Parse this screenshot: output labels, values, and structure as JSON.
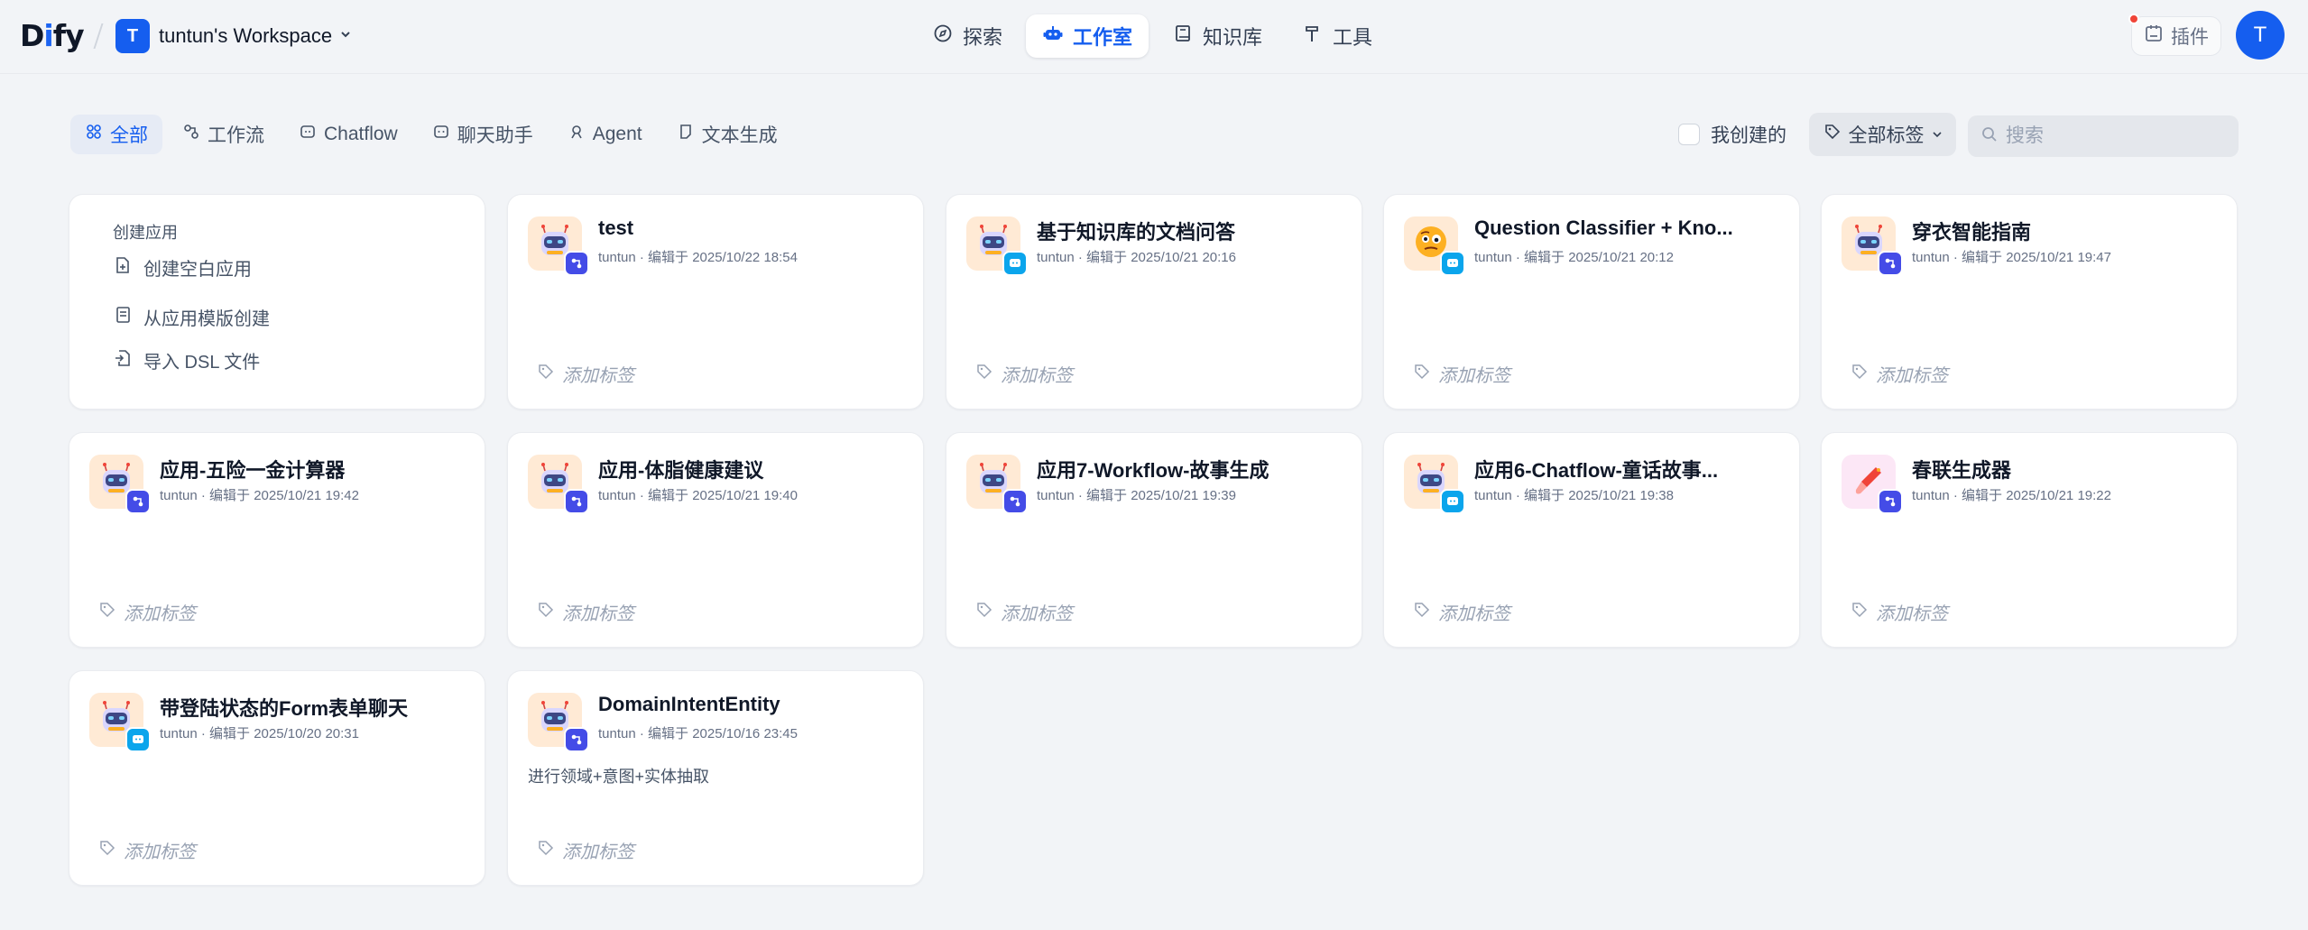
{
  "header": {
    "logo_prefix": "D",
    "logo_i": "i",
    "logo_suffix": "fy",
    "workspace_initial": "T",
    "workspace_name": "tuntun's Workspace",
    "nav": [
      {
        "label": "探索",
        "icon": "compass-icon",
        "active": false
      },
      {
        "label": "工作室",
        "icon": "robot-icon",
        "active": true
      },
      {
        "label": "知识库",
        "icon": "book-icon",
        "active": false
      },
      {
        "label": "工具",
        "icon": "hammer-icon",
        "active": false
      }
    ],
    "plugin_label": "插件",
    "user_initial": "T",
    "accent_color": "#155eef"
  },
  "filters": {
    "tabs": [
      {
        "label": "全部",
        "active": true
      },
      {
        "label": "工作流",
        "active": false
      },
      {
        "label": "Chatflow",
        "active": false
      },
      {
        "label": "聊天助手",
        "active": false
      },
      {
        "label": "Agent",
        "active": false
      },
      {
        "label": "文本生成",
        "active": false
      }
    ],
    "mine_label": "我创建的",
    "tag_filter_label": "全部标签",
    "search_placeholder": "搜索"
  },
  "create": {
    "title": "创建应用",
    "blank": "创建空白应用",
    "template": "从应用模版创建",
    "import": "导入 DSL 文件"
  },
  "apps": [
    {
      "name": "test",
      "meta": "tuntun · 编辑于 2025/10/22 18:54",
      "type": "workflow",
      "icon": "robot",
      "desc": "",
      "tag_label": "添加标签"
    },
    {
      "name": "基于知识库的文档问答",
      "meta": "tuntun · 编辑于 2025/10/21 20:16",
      "type": "chat",
      "icon": "robot",
      "desc": "",
      "tag_label": "添加标签"
    },
    {
      "name": "Question Classifier + Kno...",
      "meta": "tuntun · 编辑于 2025/10/21 20:12",
      "type": "chat",
      "icon": "thinking-face",
      "desc": "",
      "tag_label": "添加标签"
    },
    {
      "name": "穿衣智能指南",
      "meta": "tuntun · 编辑于 2025/10/21 19:47",
      "type": "workflow",
      "icon": "robot",
      "desc": "",
      "tag_label": "添加标签"
    },
    {
      "name": "应用-五险一金计算器",
      "meta": "tuntun · 编辑于 2025/10/21 19:42",
      "type": "workflow",
      "icon": "robot",
      "desc": "",
      "tag_label": "添加标签"
    },
    {
      "name": "应用-体脂健康建议",
      "meta": "tuntun · 编辑于 2025/10/21 19:40",
      "type": "workflow",
      "icon": "robot",
      "desc": "",
      "tag_label": "添加标签"
    },
    {
      "name": "应用7-Workflow-故事生成",
      "meta": "tuntun · 编辑于 2025/10/21 19:39",
      "type": "workflow",
      "icon": "robot",
      "desc": "",
      "tag_label": "添加标签"
    },
    {
      "name": "应用6-Chatflow-童话故事...",
      "meta": "tuntun · 编辑于 2025/10/21 19:38",
      "type": "chat",
      "icon": "robot",
      "desc": "",
      "tag_label": "添加标签"
    },
    {
      "name": "春联生成器",
      "meta": "tuntun · 编辑于 2025/10/21 19:22",
      "type": "workflow",
      "icon": "brush",
      "desc": "",
      "tag_label": "添加标签"
    },
    {
      "name": "带登陆状态的Form表单聊天",
      "meta": "tuntun · 编辑于 2025/10/20 20:31",
      "type": "chat",
      "icon": "robot",
      "desc": "",
      "tag_label": "添加标签"
    },
    {
      "name": "DomainIntentEntity",
      "meta": "tuntun · 编辑于 2025/10/16 23:45",
      "type": "workflow",
      "icon": "robot",
      "desc": "进行领域+意图+实体抽取",
      "tag_label": "添加标签"
    }
  ]
}
